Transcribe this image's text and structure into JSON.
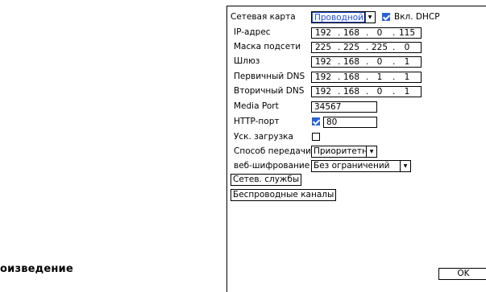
{
  "left_caption": "оизведение",
  "network": {
    "card_label": "Сетевая карта",
    "card_value": "Проводной",
    "dhcp_label": "Вкл. DHCP",
    "dhcp_checked": true,
    "ip_label": "IP-адрес",
    "ip": [
      "192",
      "168",
      "0",
      "115"
    ],
    "mask_label": "Маска подсети",
    "mask": [
      "225",
      "225",
      "225",
      "0"
    ],
    "gateway_label": "Шлюз",
    "gateway": [
      "192",
      "168",
      "0",
      "1"
    ],
    "dns1_label": "Первичный DNS",
    "dns1": [
      "192",
      "168",
      "1",
      "1"
    ],
    "dns2_label": "Вторичный DNS",
    "dns2": [
      "192",
      "168",
      "0",
      "1"
    ],
    "media_port_label": "Media Port",
    "media_port": "34567",
    "http_port_label": "HTTP-порт",
    "http_checked": true,
    "http_port": "80",
    "fast_load_label": "Уск. загрузка",
    "fast_load_checked": false,
    "transfer_label": "Способ передачи",
    "transfer_value": "Приоритетн",
    "web_enc_label": "веб-шифрование",
    "web_enc_value": "Без ограничений",
    "net_services_button": "Сетев. службы",
    "wireless_button": "Беспроводные каналы",
    "ok_button": "OK"
  },
  "icons": {
    "dropdown": "chevron-down-icon",
    "check": "checkmark-icon"
  },
  "colors": {
    "accent": "#2a62d6",
    "selected_text": "#1f4fd8"
  }
}
